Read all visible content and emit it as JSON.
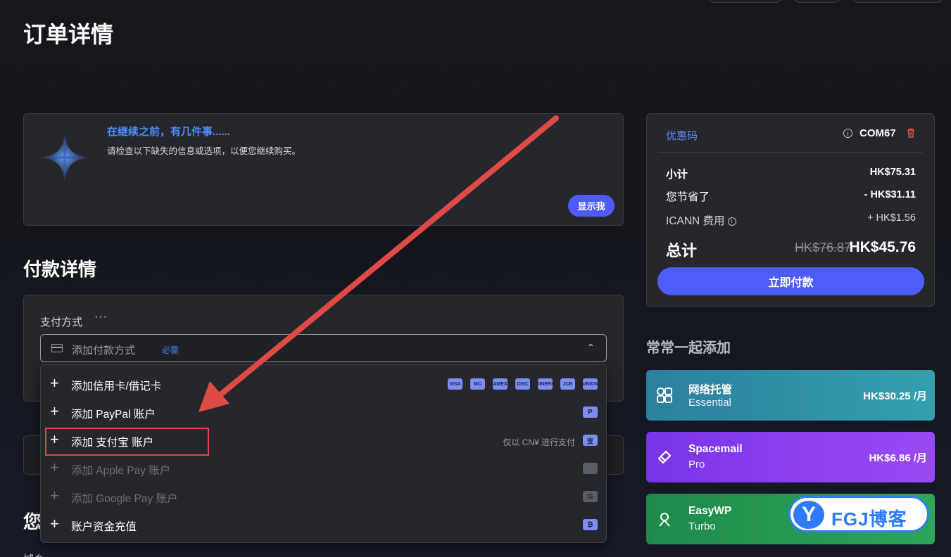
{
  "page": {
    "title": "订单详情"
  },
  "notice": {
    "title": "在继续之前，有几件事......",
    "description": "请检查以下缺失的信息或选项，以便您继续购买。",
    "button": "显示我"
  },
  "payment": {
    "section_title": "付款详情",
    "method_label": "支付方式",
    "more": "···",
    "placeholder": "添加付款方式",
    "required": "必需",
    "chevron": "⌃",
    "options": [
      {
        "label": "添加信用卡/借记卡",
        "icons": [
          "VISA",
          "MC",
          "AMEX",
          "DISC",
          "DINERS",
          "JCB",
          "UNION"
        ]
      },
      {
        "label": "添加 PayPal 账户",
        "icons": [
          "P"
        ]
      },
      {
        "label": "添加 支付宝 账户",
        "note": "仅以 CN¥ 进行支付",
        "icons": [
          "支"
        ]
      },
      {
        "label": "添加 Apple Pay 账户",
        "icons": [
          ""
        ]
      },
      {
        "label": "添加 Google Pay 账户",
        "icons": [
          "G"
        ]
      },
      {
        "label": "账户资金充值",
        "icons": [
          "₿"
        ]
      }
    ]
  },
  "summary": {
    "promo_label": "优惠码",
    "promo_code": "COM67",
    "subtotal_label": "小计",
    "subtotal": "HK$75.31",
    "saved_label": "您节省了",
    "saved": "- HK$31.11",
    "icann_label": "ICANN 费用",
    "icann": "+ HK$1.56",
    "total_label": "总计",
    "total_old": "HK$76.87",
    "total_new": "HK$45.76",
    "pay_button": "立即付款"
  },
  "addons": {
    "title": "常常一起添加",
    "items": [
      {
        "name": "网络托管",
        "sub": "Essential",
        "price": "HK$30.25 /月"
      },
      {
        "name": "Spacemail",
        "sub": "Pro",
        "price": "HK$6.86 /月"
      },
      {
        "name": "EasyWP",
        "sub": "Turbo"
      }
    ]
  },
  "watermark": {
    "logo": "Y",
    "text": "FGJ博客"
  },
  "cutoff": {
    "title": "您",
    "text": "城乡"
  },
  "colors": {
    "accent": "#4c5cff",
    "link": "#4d8dff",
    "highlight": "#dd4a44",
    "arrow": "#e04a44"
  }
}
